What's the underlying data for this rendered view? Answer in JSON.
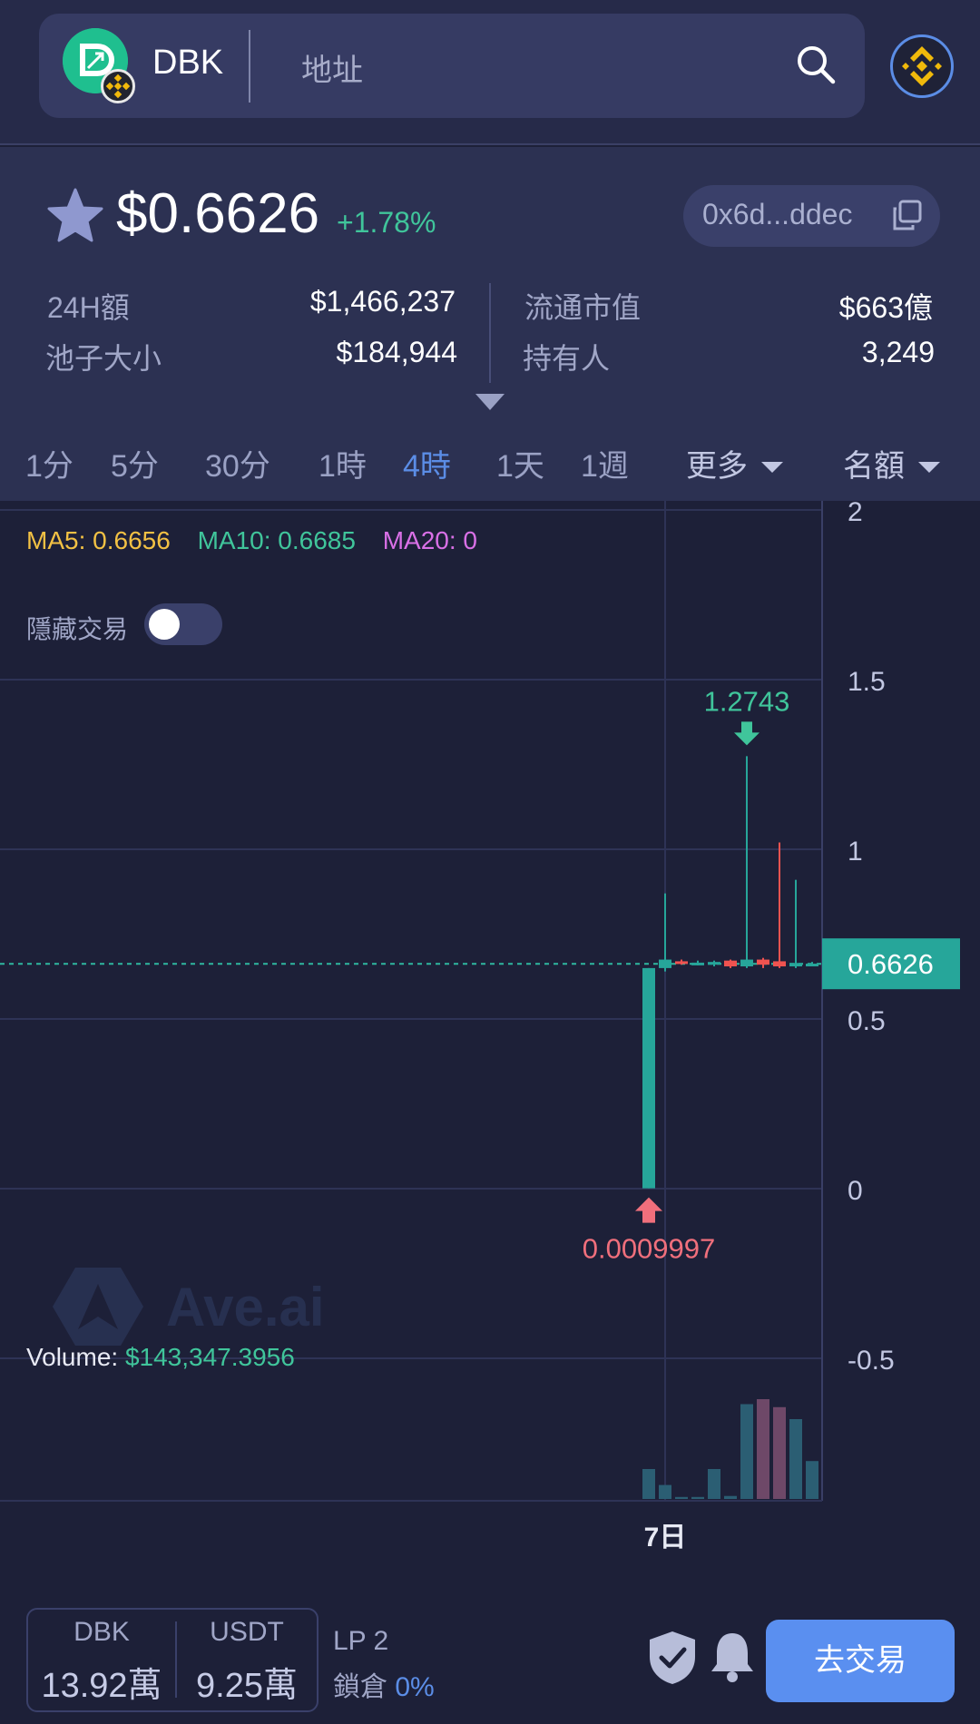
{
  "header": {
    "token_symbol": "DBK",
    "address_placeholder": "地址"
  },
  "price_info": {
    "price": "$0.6626",
    "change": "+1.78%",
    "contract_short": "0x6d...ddec"
  },
  "stats": [
    {
      "label": "24H額",
      "value": "$1,466,237"
    },
    {
      "label": "池子大小",
      "value": "$184,944"
    },
    {
      "label": "流通市值",
      "value": "$663億"
    },
    {
      "label": "持有人",
      "value": "3,249"
    }
  ],
  "intervals": [
    {
      "label": "1分",
      "active": false
    },
    {
      "label": "5分",
      "active": false
    },
    {
      "label": "30分",
      "active": false
    },
    {
      "label": "1時",
      "active": false
    },
    {
      "label": "4時",
      "active": true
    },
    {
      "label": "1天",
      "active": false
    },
    {
      "label": "1週",
      "active": false
    }
  ],
  "dropdowns": {
    "more": "更多",
    "ranking": "名額"
  },
  "indicators": {
    "ma5_label": "MA5:",
    "ma5_value": "0.6656",
    "ma10_label": "MA10:",
    "ma10_value": "0.6685",
    "ma20_label": "MA20:",
    "ma20_value": "0",
    "hide_trades": "隱藏交易",
    "volume_label": "Volume:",
    "volume_value": "$143,347.3956",
    "watermark": "Ave.ai"
  },
  "colors": {
    "ma5": "#f2c144",
    "ma10": "#40c59b",
    "ma20": "#d970e6",
    "up": "#26a69a",
    "down": "#ef5350",
    "accent": "#5b8de6"
  },
  "chart_data": {
    "type": "candlestick",
    "y_ticks": [
      "2",
      "1.5",
      "1",
      "0.5",
      "0",
      "-0.5"
    ],
    "y_tick_values": [
      2,
      1.5,
      1,
      0.5,
      0,
      -0.5
    ],
    "ylim": [
      -0.9,
      2.02
    ],
    "x_tick_label": "7日",
    "current_price": 0.6626,
    "current_price_label": "0.6626",
    "high_marker": {
      "value": 1.2743,
      "label": "1.2743"
    },
    "low_marker": {
      "value": 0.0009997,
      "label": "0.0009997"
    },
    "candles": [
      {
        "open": 0.0009997,
        "close": 0.65,
        "high": 0.65,
        "low": 0.0009997,
        "vol": 0.3
      },
      {
        "open": 0.65,
        "close": 0.675,
        "high": 0.87,
        "low": 0.64,
        "vol": 0.14
      },
      {
        "open": 0.67,
        "close": 0.668,
        "high": 0.675,
        "low": 0.66,
        "vol": 0.02
      },
      {
        "open": 0.665,
        "close": 0.666,
        "high": 0.672,
        "low": 0.658,
        "vol": 0.02
      },
      {
        "open": 0.66,
        "close": 0.668,
        "high": 0.672,
        "low": 0.655,
        "vol": 0.3
      },
      {
        "open": 0.672,
        "close": 0.655,
        "high": 0.675,
        "low": 0.65,
        "vol": 0.03
      },
      {
        "open": 0.655,
        "close": 0.675,
        "high": 1.2743,
        "low": 0.65,
        "vol": 0.95
      },
      {
        "open": 0.675,
        "close": 0.66,
        "high": 0.68,
        "low": 0.65,
        "vol": 1.0
      },
      {
        "open": 0.67,
        "close": 0.655,
        "high": 1.02,
        "low": 0.65,
        "vol": 0.92
      },
      {
        "open": 0.655,
        "close": 0.665,
        "high": 0.91,
        "low": 0.65,
        "vol": 0.8
      },
      {
        "open": 0.663,
        "close": 0.663,
        "high": 0.668,
        "low": 0.66,
        "vol": 0.38
      }
    ]
  },
  "bottom": {
    "base_symbol": "DBK",
    "base_amount": "13.92萬",
    "quote_symbol": "USDT",
    "quote_amount": "9.25萬",
    "lp_label": "LP 2",
    "lock_label": "鎖倉",
    "lock_value": "0%",
    "trade_button": "去交易"
  }
}
